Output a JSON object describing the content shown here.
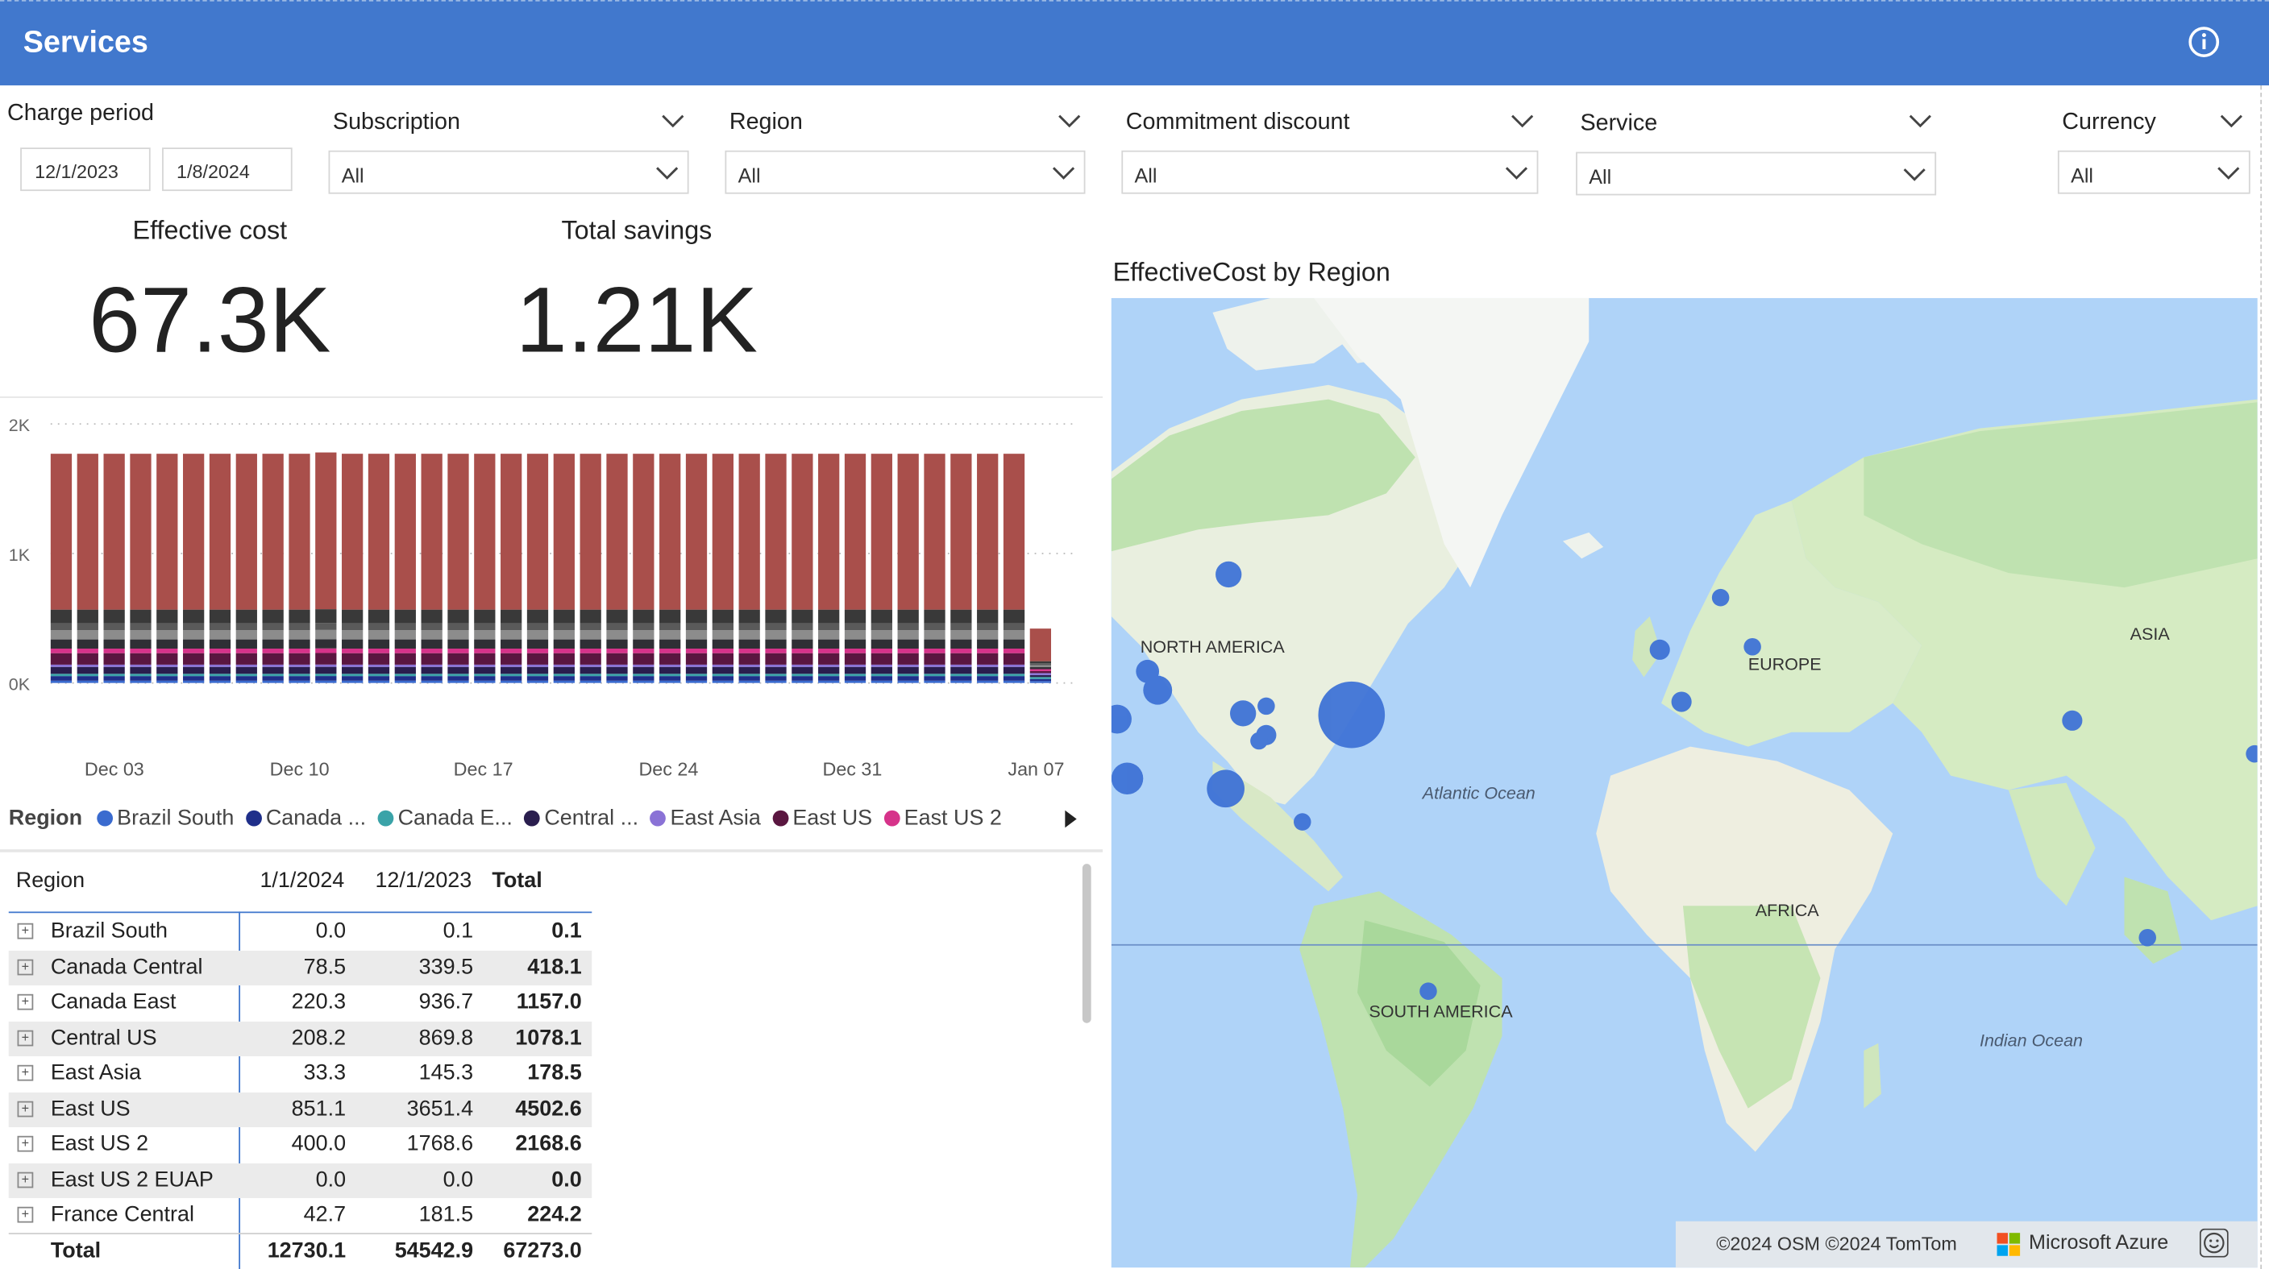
{
  "header": {
    "title": "Services"
  },
  "filters": {
    "charge_period": {
      "label": "Charge period",
      "start": "12/1/2023",
      "end": "1/8/2024"
    },
    "subscription": {
      "label": "Subscription",
      "value": "All"
    },
    "region": {
      "label": "Region",
      "value": "All"
    },
    "commitment_discount": {
      "label": "Commitment discount",
      "value": "All"
    },
    "service": {
      "label": "Service",
      "value": "All"
    },
    "currency": {
      "label": "Currency",
      "value": "All"
    }
  },
  "kpis": {
    "effective_cost": {
      "label": "Effective cost",
      "value": "67.3K"
    },
    "total_savings": {
      "label": "Total savings",
      "value": "1.21K"
    }
  },
  "chart_data": {
    "type": "bar",
    "stacked": true,
    "y_ticks": [
      "2K",
      "1K",
      "0K"
    ],
    "ylim": [
      0,
      2000
    ],
    "x_ticks": [
      "Dec 03",
      "Dec 10",
      "Dec 17",
      "Dec 24",
      "Dec 31",
      "Jan 07"
    ],
    "days": 38,
    "day_totals": [
      1770,
      1770,
      1770,
      1770,
      1770,
      1770,
      1770,
      1770,
      1770,
      1770,
      1780,
      1770,
      1770,
      1770,
      1770,
      1770,
      1770,
      1770,
      1770,
      1770,
      1770,
      1770,
      1770,
      1770,
      1770,
      1770,
      1770,
      1770,
      1770,
      1770,
      1770,
      1770,
      1770,
      1770,
      1770,
      1770,
      1770,
      420
    ],
    "segments": [
      {
        "color": "#3a6bcf",
        "fraction": 0.01
      },
      {
        "color": "#1f2f8a",
        "fraction": 0.02
      },
      {
        "color": "#3aa3a8",
        "fraction": 0.01
      },
      {
        "color": "#2a1e4e",
        "fraction": 0.03
      },
      {
        "color": "#8a72d6",
        "fraction": 0.01
      },
      {
        "color": "#5a1640",
        "fraction": 0.05
      },
      {
        "color": "#d6338a",
        "fraction": 0.02
      },
      {
        "color": "#2f2f35",
        "fraction": 0.04
      },
      {
        "color": "#8c8c8c",
        "fraction": 0.04
      },
      {
        "color": "#5a5a5a",
        "fraction": 0.03
      },
      {
        "color": "#393939",
        "fraction": 0.06
      },
      {
        "color": "#a94f4b",
        "fraction": 0.68
      }
    ],
    "legend": {
      "title": "Region",
      "items": [
        {
          "name": "Brazil South",
          "color": "#3a6bcf"
        },
        {
          "name": "Canada ...",
          "color": "#1f2f8a"
        },
        {
          "name": "Canada E...",
          "color": "#3aa3a8"
        },
        {
          "name": "Central ...",
          "color": "#2a1e4e"
        },
        {
          "name": "East Asia",
          "color": "#8a72d6"
        },
        {
          "name": "East US",
          "color": "#5a1640"
        },
        {
          "name": "East US 2",
          "color": "#d6338a"
        }
      ]
    }
  },
  "matrix": {
    "headers": [
      "Region",
      "1/1/2024",
      "12/1/2023",
      "Total"
    ],
    "rows": [
      {
        "region": "Brazil South",
        "c1": "0.0",
        "c2": "0.1",
        "total": "0.1"
      },
      {
        "region": "Canada Central",
        "c1": "78.5",
        "c2": "339.5",
        "total": "418.1"
      },
      {
        "region": "Canada East",
        "c1": "220.3",
        "c2": "936.7",
        "total": "1157.0"
      },
      {
        "region": "Central US",
        "c1": "208.2",
        "c2": "869.8",
        "total": "1078.1"
      },
      {
        "region": "East Asia",
        "c1": "33.3",
        "c2": "145.3",
        "total": "178.5"
      },
      {
        "region": "East US",
        "c1": "851.1",
        "c2": "3651.4",
        "total": "4502.6"
      },
      {
        "region": "East US 2",
        "c1": "400.0",
        "c2": "1768.6",
        "total": "2168.6"
      },
      {
        "region": "East US 2 EUAP",
        "c1": "0.0",
        "c2": "0.0",
        "total": "0.0"
      },
      {
        "region": "France Central",
        "c1": "42.7",
        "c2": "181.5",
        "total": "224.2"
      }
    ],
    "total": {
      "label": "Total",
      "c1": "12730.1",
      "c2": "54542.9",
      "total": "67273.0"
    }
  },
  "map": {
    "title": "EffectiveCost by Region",
    "labels": [
      "NORTH AMERICA",
      "EUROPE",
      "ASIA",
      "AFRICA",
      "SOUTH AMERICA"
    ],
    "oceans": [
      "Atlantic Ocean",
      "Indian Ocean"
    ],
    "attribution": "©2024 OSM  ©2024 TomTom",
    "brand": "Microsoft Azure",
    "bubble_color": "#3f73d6"
  }
}
